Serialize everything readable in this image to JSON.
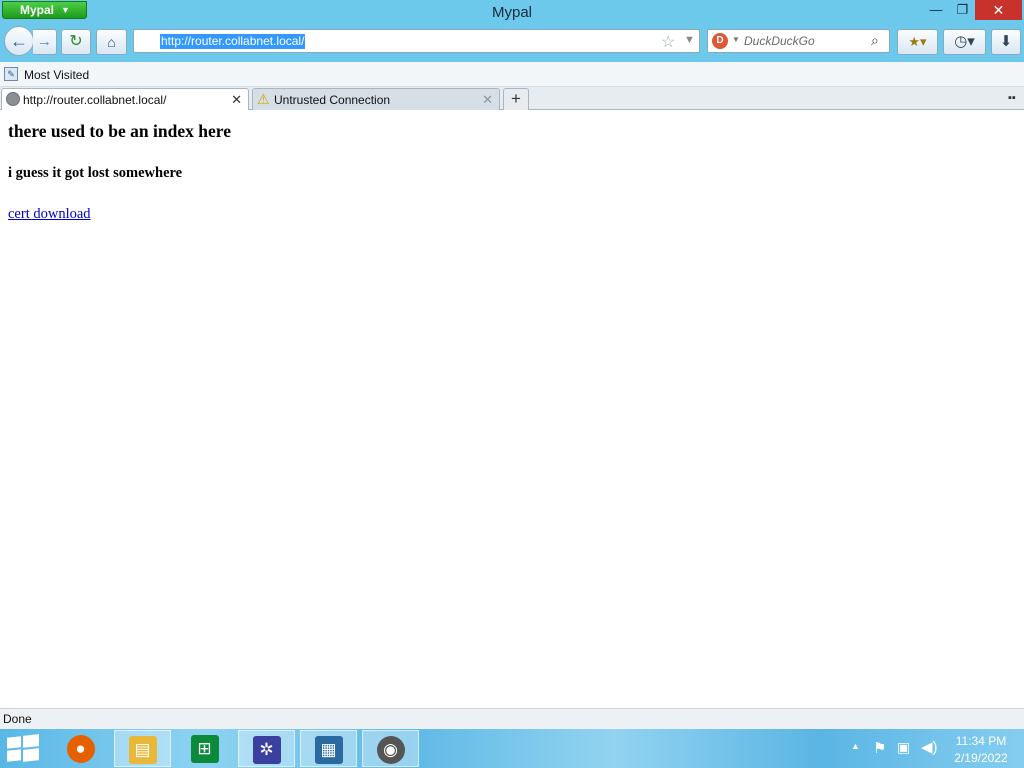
{
  "window": {
    "app_menu_label": "Mypal",
    "title": "Mypal",
    "minimize_glyph": "—",
    "maximize_glyph": "❐",
    "close_glyph": "✕"
  },
  "navbar": {
    "back_glyph": "←",
    "forward_glyph": "→",
    "reload_glyph": "↻",
    "home_glyph": "⌂",
    "url": "http://router.collabnet.local/",
    "bookmark_star_glyph": "☆",
    "url_dropdown_glyph": "▼",
    "search_placeholder": "DuckDuckGo",
    "search_engine_glyph": "D",
    "search_go_glyph": "⌕",
    "bookmarks_glyph": "★▾",
    "history_glyph": "◷▾",
    "downloads_glyph": "⬇"
  },
  "bookmarks_bar": {
    "items": [
      {
        "label": "Most Visited",
        "icon": "most-visited-icon"
      }
    ]
  },
  "tabs": [
    {
      "label": "http://router.collabnet.local/",
      "icon": "globe-icon",
      "selected": true
    },
    {
      "label": "Untrusted Connection",
      "icon": "warning-icon",
      "selected": false
    }
  ],
  "tabs_ui": {
    "close_glyph": "✕",
    "new_tab_glyph": "+",
    "tab_list_glyph": "▪▪"
  },
  "page": {
    "heading": "there used to be an index here",
    "subheading": "i guess it got lost somewhere",
    "link_text": "cert download"
  },
  "status": {
    "text": "Done"
  },
  "taskbar": {
    "items": [
      {
        "name": "firefox",
        "glyph": "●",
        "color": "#e66000"
      },
      {
        "name": "file-explorer",
        "glyph": "▤",
        "color": "#e8b83a"
      },
      {
        "name": "store",
        "glyph": "⊞",
        "color": "#0a8a3a"
      },
      {
        "name": "settings",
        "glyph": "✲",
        "color": "#3b3fa0"
      },
      {
        "name": "news",
        "glyph": "▦",
        "color": "#2a6aa0"
      },
      {
        "name": "mypal",
        "glyph": "◉",
        "color": "#555"
      }
    ],
    "tray": {
      "up_glyph": "▲",
      "flag_glyph": "⚑",
      "network_glyph": "▣",
      "volume_glyph": "◀)",
      "time": "11:34 PM",
      "date": "2/19/2022"
    }
  }
}
